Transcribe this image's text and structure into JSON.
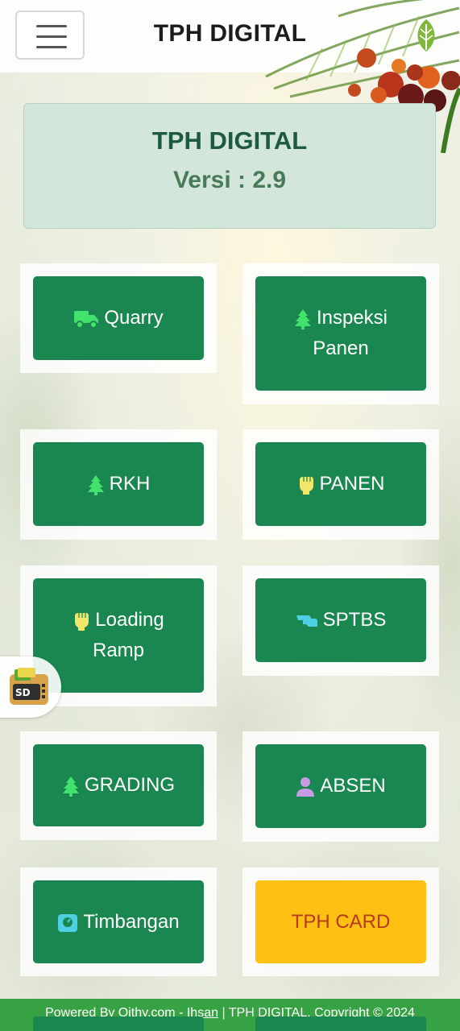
{
  "header": {
    "title": "TPH DIGITAL"
  },
  "version_card": {
    "title": "TPH DIGITAL",
    "version": "Versi : 2.9"
  },
  "menu": [
    {
      "label": "Quarry",
      "icon": "truck-icon",
      "icon_color": "#41e36d"
    },
    {
      "label": "Inspeksi Panen",
      "icon": "tree-icon",
      "icon_color": "#41e36d"
    },
    {
      "label": "RKH",
      "icon": "tree-icon",
      "icon_color": "#41e36d"
    },
    {
      "label": "PANEN",
      "icon": "fist-icon",
      "icon_color": "#f2e76a"
    },
    {
      "label": "Loading Ramp",
      "icon": "fist-icon",
      "icon_color": "#f2e76a"
    },
    {
      "label": "SPTBS",
      "icon": "hand-icon",
      "icon_color": "#4dd0e1"
    },
    {
      "label": "GRADING",
      "icon": "tree-icon",
      "icon_color": "#41e36d"
    },
    {
      "label": "ABSEN",
      "icon": "user-icon",
      "icon_color": "#c79be6"
    },
    {
      "label": "Timbangan",
      "icon": "scale-icon",
      "icon_color": "#4dd0e1"
    },
    {
      "label": "TPH CARD",
      "icon": "",
      "icon_color": "#fdc013"
    }
  ],
  "footer": {
    "prefix": "Powered By Qithy.com - ",
    "link": "Ihsan",
    "suffix": " | TPH DIGITAL, Copyright © 2024"
  },
  "colors": {
    "primary_green": "#1a8750",
    "footer_green": "#37a244",
    "card_bg": "#d2e6dc",
    "yellow": "#fdc013"
  }
}
